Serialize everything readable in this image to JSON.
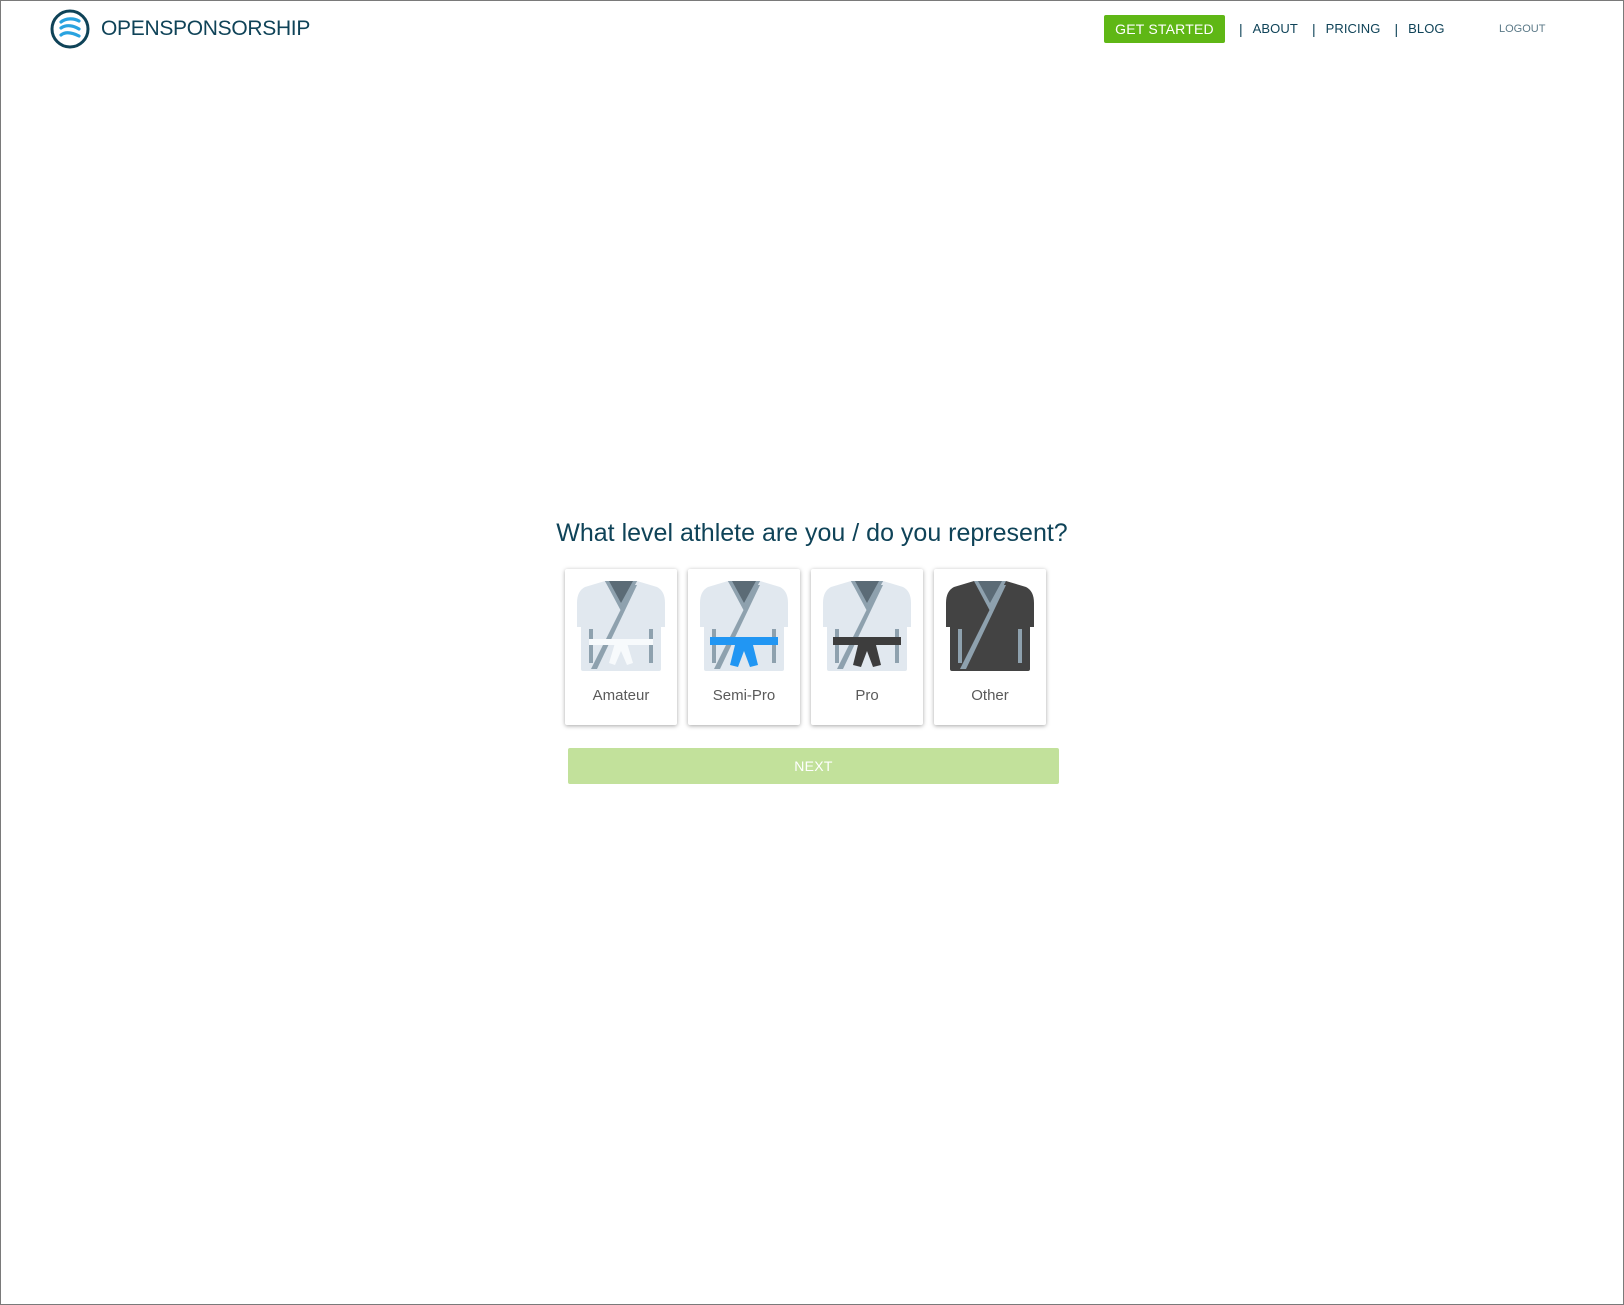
{
  "header": {
    "logo_text": "OPENSPONSORSHIP",
    "get_started_label": "GET STARTED",
    "separator": "|",
    "nav": {
      "about": "ABOUT",
      "pricing": "PRICING",
      "blog": "BLOG"
    },
    "logout_label": "LOGOUT"
  },
  "main": {
    "question": "What level athlete are you / do you represent?",
    "options": [
      {
        "label": "Amateur",
        "icon": "white-belt-gi-icon",
        "gi_color": "#e1e8ef",
        "belt_color": "#f7fafc"
      },
      {
        "label": "Semi-Pro",
        "icon": "blue-belt-gi-icon",
        "gi_color": "#e1e8ef",
        "belt_color": "#2196f3"
      },
      {
        "label": "Pro",
        "icon": "black-belt-gi-icon",
        "gi_color": "#e1e8ef",
        "belt_color": "#3d3d3d"
      },
      {
        "label": "Other",
        "icon": "dark-gi-icon",
        "gi_color": "#434343",
        "belt_color": null
      }
    ],
    "next_label": "NEXT"
  },
  "colors": {
    "brand": "#0f4358",
    "accent_green": "#5fb715",
    "next_disabled": "#c2e19b",
    "logo_blue": "#29a3e0"
  }
}
